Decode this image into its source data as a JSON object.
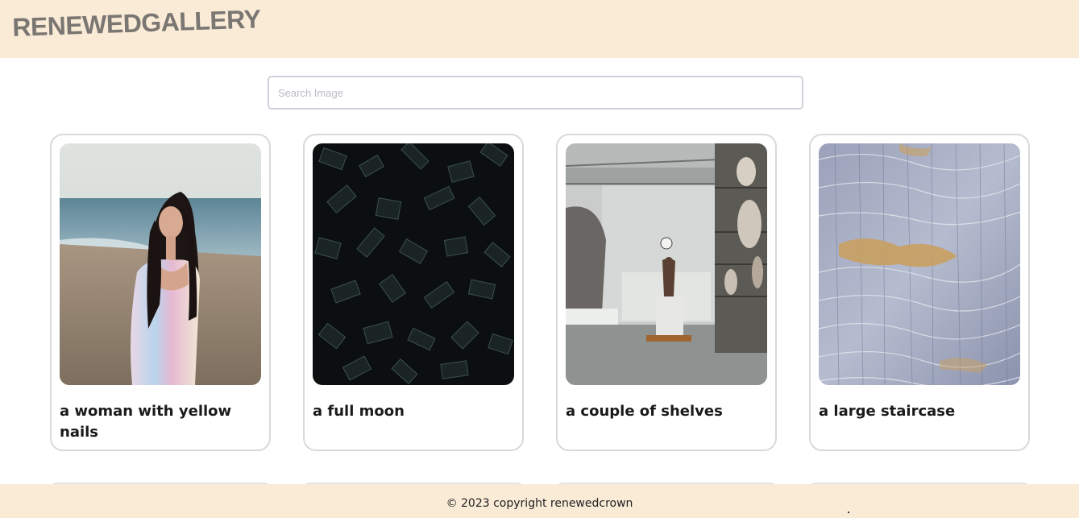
{
  "header": {
    "logo_text": "RENEWEDGALLERY"
  },
  "search": {
    "placeholder": "Search Image",
    "value": ""
  },
  "gallery": {
    "cards": [
      {
        "caption": "a woman with yellow nails",
        "image": "woman-on-beach-photo"
      },
      {
        "caption": "a full moon",
        "image": "dark-glass-shards-photo"
      },
      {
        "caption": "a couple of shelves",
        "image": "sculpture-studio-photo"
      },
      {
        "caption": "a large staircase",
        "image": "aerial-textured-landscape-photo"
      }
    ]
  },
  "footer": {
    "copyright": "© 2023 copyright renewedcrown"
  },
  "colors": {
    "header_bg": "#faebd7",
    "footer_bg": "#faebd7",
    "logo": "#7a7672",
    "card_border": "#d9d9d9"
  }
}
